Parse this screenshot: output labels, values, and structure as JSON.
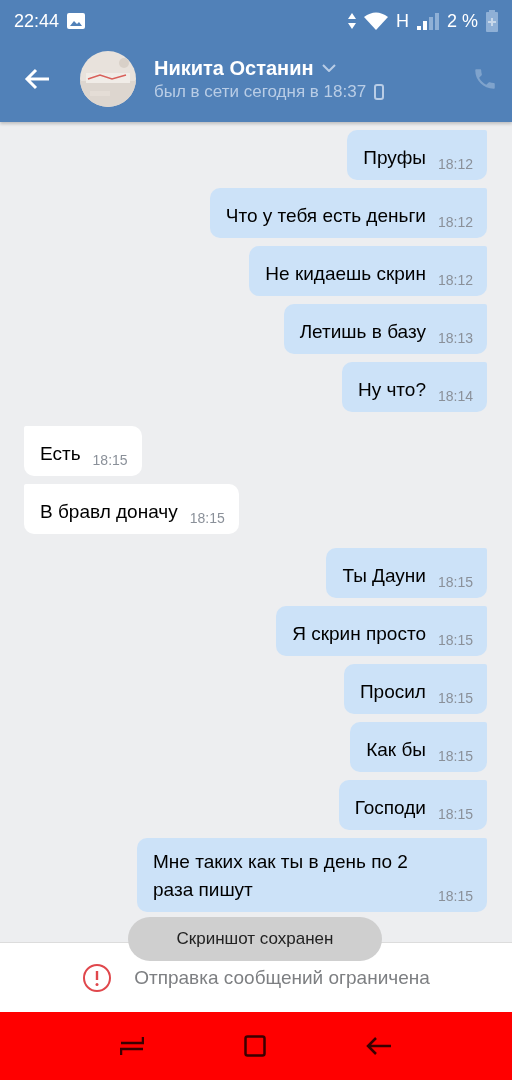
{
  "status_bar": {
    "time": "22:44",
    "network": "H",
    "battery": "2 %"
  },
  "header": {
    "name": "Никита Останин",
    "status": "был в сети сегодня в 18:37"
  },
  "messages": [
    {
      "text": "Пруфы",
      "time": "18:12",
      "outgoing": true
    },
    {
      "text": "Что у тебя есть деньги",
      "time": "18:12",
      "outgoing": true
    },
    {
      "text": "Не кидаешь скрин",
      "time": "18:12",
      "outgoing": true
    },
    {
      "text": "Летишь в базу",
      "time": "18:13",
      "outgoing": true
    },
    {
      "text": "Ну что?",
      "time": "18:14",
      "outgoing": true
    },
    {
      "text": "Есть",
      "time": "18:15",
      "outgoing": false
    },
    {
      "text": "В бравл доначу",
      "time": "18:15",
      "outgoing": false
    },
    {
      "text": "Ты Дауни",
      "time": "18:15",
      "outgoing": true
    },
    {
      "text": "Я скрин просто",
      "time": "18:15",
      "outgoing": true
    },
    {
      "text": "Просил",
      "time": "18:15",
      "outgoing": true
    },
    {
      "text": "Как бы",
      "time": "18:15",
      "outgoing": true
    },
    {
      "text": "Господи",
      "time": "18:15",
      "outgoing": true
    },
    {
      "text": "Мне таких как ты в день по 2 раза пишут",
      "time": "18:15",
      "outgoing": true
    }
  ],
  "toast": "Скриншот сохранен",
  "notice": "Отправка сообщений ограничена"
}
